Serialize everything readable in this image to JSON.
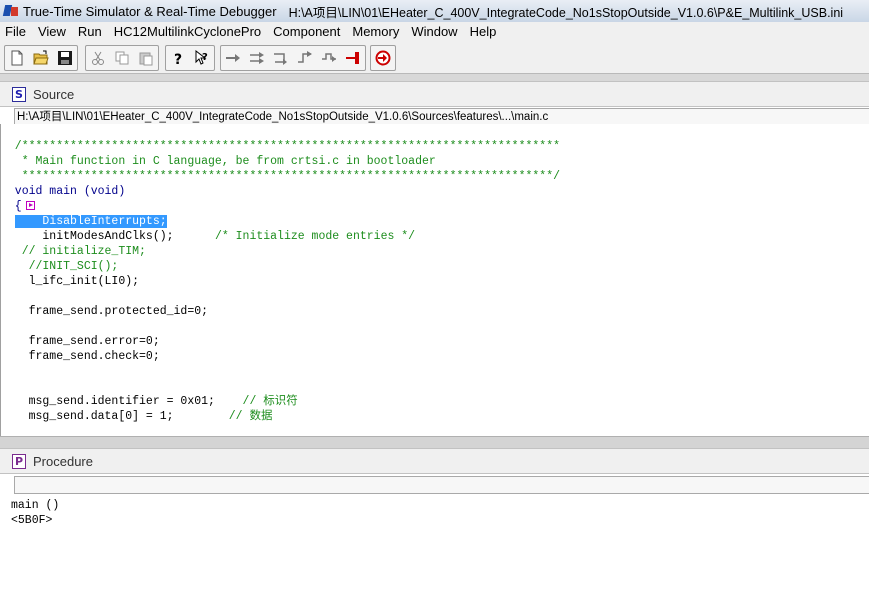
{
  "window": {
    "app_title": "True-Time Simulator & Real-Time Debugger",
    "config_path": "H:\\A项目\\LIN\\01\\EHeater_C_400V_IntegrateCode_No1sStopOutside_V1.0.6\\P&E_Multilink_USB.ini"
  },
  "menu": [
    "File",
    "View",
    "Run",
    "HC12MultilinkCyclonePro",
    "Component",
    "Memory",
    "Window",
    "Help"
  ],
  "toolbar": {
    "file_group": [
      "new-file-icon",
      "open-folder-icon",
      "save-icon"
    ],
    "edit_group": [
      "cut-icon",
      "copy-icon",
      "paste-icon"
    ],
    "help_group": [
      "help-icon",
      "context-help-icon"
    ],
    "run_group": [
      "start-continue-icon",
      "single-step-icon",
      "step-over-icon",
      "step-out-icon",
      "assembly-step-icon",
      "halt-icon"
    ],
    "reset_group": [
      "reset-target-icon"
    ]
  },
  "source_panel": {
    "badge": "S",
    "title": "Source",
    "file_path": "H:\\A项目\\LIN\\01\\EHeater_C_400V_IntegrateCode_No1sStopOutside_V1.0.6\\Sources\\features\\...\\main.c",
    "lines": [
      {
        "kind": "blank",
        "text": ""
      },
      {
        "kind": "comment",
        "text": "  /******************************************************************************"
      },
      {
        "kind": "comment",
        "text": "   * Main function in C language, be from crtsi.c in bootloader"
      },
      {
        "kind": "comment",
        "text": "   *****************************************************************************/"
      },
      {
        "kind": "keyword",
        "text": "  void main (void)"
      },
      {
        "kind": "brace",
        "text": "  {"
      },
      {
        "kind": "highlight",
        "text": "    DisableInterrupts;"
      },
      {
        "kind": "mixed",
        "code": "      initModesAndClks();      ",
        "comment": "/* Initialize mode entries */"
      },
      {
        "kind": "comment",
        "text": "   // initialize_TIM;"
      },
      {
        "kind": "comment",
        "text": "    //INIT_SCI();"
      },
      {
        "kind": "code",
        "text": "    l_ifc_init(LI0);"
      },
      {
        "kind": "blank",
        "text": ""
      },
      {
        "kind": "code",
        "text": "    frame_send.protected_id=0;"
      },
      {
        "kind": "blank",
        "text": ""
      },
      {
        "kind": "code",
        "text": "    frame_send.error=0;"
      },
      {
        "kind": "code",
        "text": "    frame_send.check=0;"
      },
      {
        "kind": "blank",
        "text": ""
      },
      {
        "kind": "blank",
        "text": ""
      },
      {
        "kind": "mixed",
        "code": "    msg_send.identifier = 0x01;    ",
        "comment": "// 标识符"
      },
      {
        "kind": "mixed",
        "code": "    msg_send.data[0] = 1;        ",
        "comment": "// 数据"
      }
    ]
  },
  "procedure_panel": {
    "badge": "P",
    "title": "Procedure",
    "lines": [
      "main ()",
      "<5B0F>"
    ]
  }
}
